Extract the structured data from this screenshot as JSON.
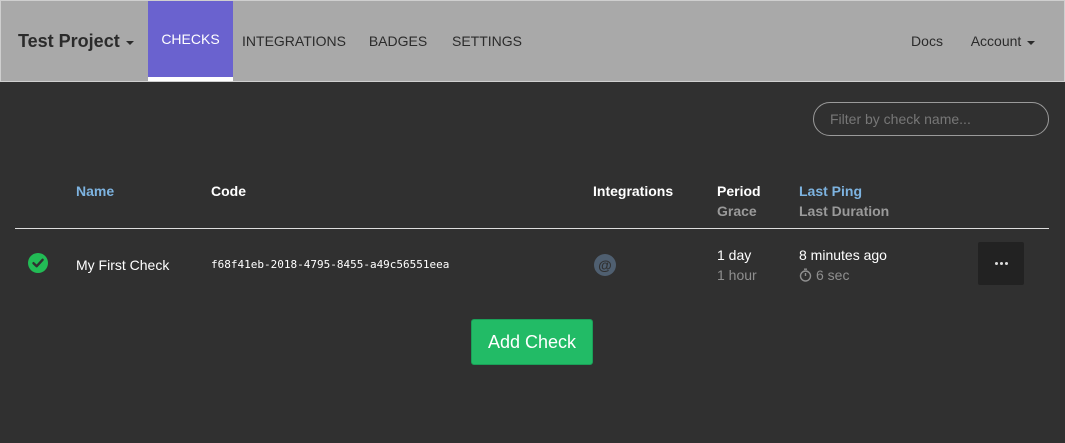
{
  "nav": {
    "brand": "Test Project",
    "tabs": [
      {
        "label": "CHECKS",
        "active": true
      },
      {
        "label": "INTEGRATIONS"
      },
      {
        "label": "BADGES"
      },
      {
        "label": "SETTINGS"
      }
    ],
    "docs": "Docs",
    "account": "Account"
  },
  "filter": {
    "placeholder": "Filter by check name..."
  },
  "table": {
    "headers": {
      "name": "Name",
      "code": "Code",
      "integrations": "Integrations",
      "period": "Period",
      "grace": "Grace",
      "last_ping": "Last Ping",
      "last_duration": "Last Duration"
    },
    "rows": [
      {
        "status": "up",
        "name": "My First Check",
        "code": "f68f41eb-2018-4795-8455-a49c56551eea",
        "integration_icon": "email-icon",
        "period": "1 day",
        "grace": "1 hour",
        "last_ping": "8 minutes ago",
        "last_duration": "6 sec"
      }
    ]
  },
  "add_check": "Add Check",
  "colors": {
    "background": "#303030",
    "navbar": "#a9a9a9",
    "active_tab": "#6a62cf",
    "status_up": "#22bb55",
    "add_button": "#22bb66",
    "sort_header": "#7db3e0"
  }
}
